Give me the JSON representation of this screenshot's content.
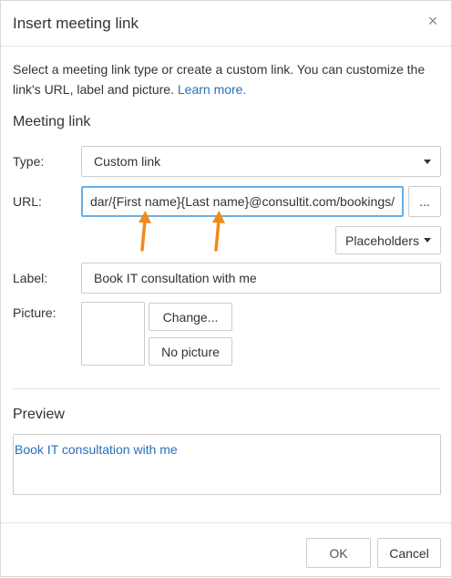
{
  "dialog": {
    "title": "Insert meeting link",
    "close_glyph": "×"
  },
  "description": {
    "text": "Select a meeting link type or create a custom link. You can customize the link's URL, label and picture.",
    "learn_more": "Learn more."
  },
  "meeting_link": {
    "heading": "Meeting link",
    "type_label": "Type:",
    "type_value": "Custom link",
    "url_label": "URL:",
    "url_value": "dar/{First name}{Last name}@consultit.com/bookings/",
    "browse_label": "...",
    "placeholders_label": "Placeholders",
    "label_label": "Label:",
    "label_value": "Book IT consultation with me",
    "picture_label": "Picture:",
    "change_label": "Change...",
    "no_picture_label": "No picture"
  },
  "preview": {
    "heading": "Preview",
    "link_text": "Book IT consultation with me"
  },
  "footer": {
    "ok_label": "OK",
    "cancel_label": "Cancel"
  },
  "colors": {
    "link": "#2a6ebb",
    "annotation_arrow": "#f08a1c",
    "focus_border": "#66afe9"
  }
}
